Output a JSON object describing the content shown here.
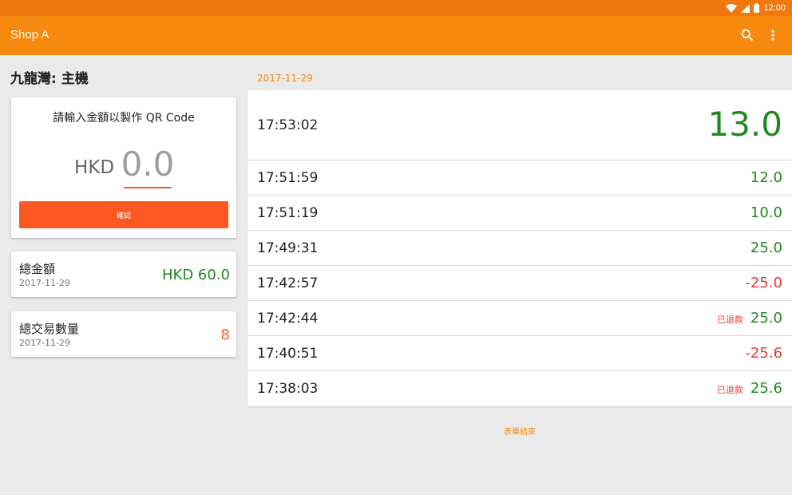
{
  "status_bar": {
    "time": "12:00"
  },
  "app_bar": {
    "title": "Shop A"
  },
  "store": {
    "title": "九龍灣: 主機"
  },
  "qr_card": {
    "prompt": "請輸入金額以製作 QR Code",
    "currency": "HKD",
    "amount_value": "0.0",
    "confirm_label": "確認"
  },
  "total_card": {
    "label": "總金額",
    "date": "2017-11-29",
    "value": "HKD 60.0"
  },
  "count_card": {
    "label": "總交易數量",
    "date": "2017-11-29",
    "value": "8"
  },
  "transactions": {
    "date": "2017-11-29",
    "rows": [
      {
        "time": "17:53:02",
        "amount": "13.0",
        "refund": ""
      },
      {
        "time": "17:51:59",
        "amount": "12.0",
        "refund": ""
      },
      {
        "time": "17:51:19",
        "amount": "10.0",
        "refund": ""
      },
      {
        "time": "17:49:31",
        "amount": "25.0",
        "refund": ""
      },
      {
        "time": "17:42:57",
        "amount": "-25.0",
        "refund": ""
      },
      {
        "time": "17:42:44",
        "amount": "25.0",
        "refund": "已退款"
      },
      {
        "time": "17:40:51",
        "amount": "-25.6",
        "refund": ""
      },
      {
        "time": "17:38:03",
        "amount": "25.6",
        "refund": "已退款"
      }
    ],
    "end_label": "表單結束"
  },
  "colors": {
    "accent": "#f7890e",
    "status_bar": "#f0780c",
    "button": "#ff5722",
    "positive": "#1e8a1e",
    "negative": "#e53935"
  },
  "icons": {
    "status": [
      "wifi-icon",
      "signal-icon",
      "battery-icon"
    ],
    "app_bar": [
      "search-icon",
      "more-vert-icon"
    ]
  }
}
